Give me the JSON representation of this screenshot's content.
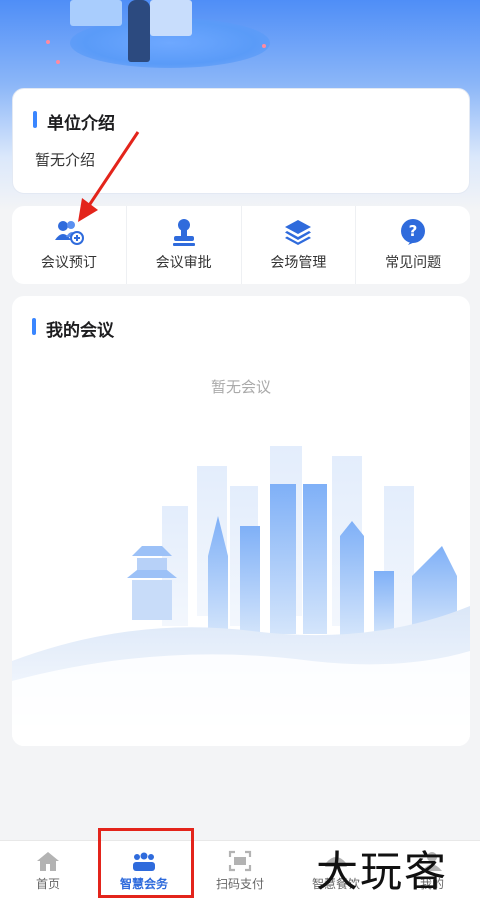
{
  "colors": {
    "accent": "#3a86ff",
    "tab_active": "#2f6bdc",
    "highlight_box": "#e3241b"
  },
  "intro": {
    "title": "单位介绍",
    "text": "暂无介绍"
  },
  "menu": [
    {
      "label": "会议预订",
      "icon": "meeting-booking-icon"
    },
    {
      "label": "会议审批",
      "icon": "approval-stamp-icon"
    },
    {
      "label": "会场管理",
      "icon": "layers-icon"
    },
    {
      "label": "常见问题",
      "icon": "question-icon"
    }
  ],
  "meetings": {
    "title": "我的会议",
    "empty": "暂无会议"
  },
  "tabs": [
    {
      "label": "首页",
      "icon": "home-icon"
    },
    {
      "label": "智慧会务",
      "icon": "meeting-group-icon",
      "active": true
    },
    {
      "label": "扫码支付",
      "icon": "scan-icon"
    },
    {
      "label": "智慧餐饮",
      "icon": "dining-icon"
    },
    {
      "label": "我的",
      "icon": "profile-icon"
    }
  ],
  "watermark": "大玩客"
}
